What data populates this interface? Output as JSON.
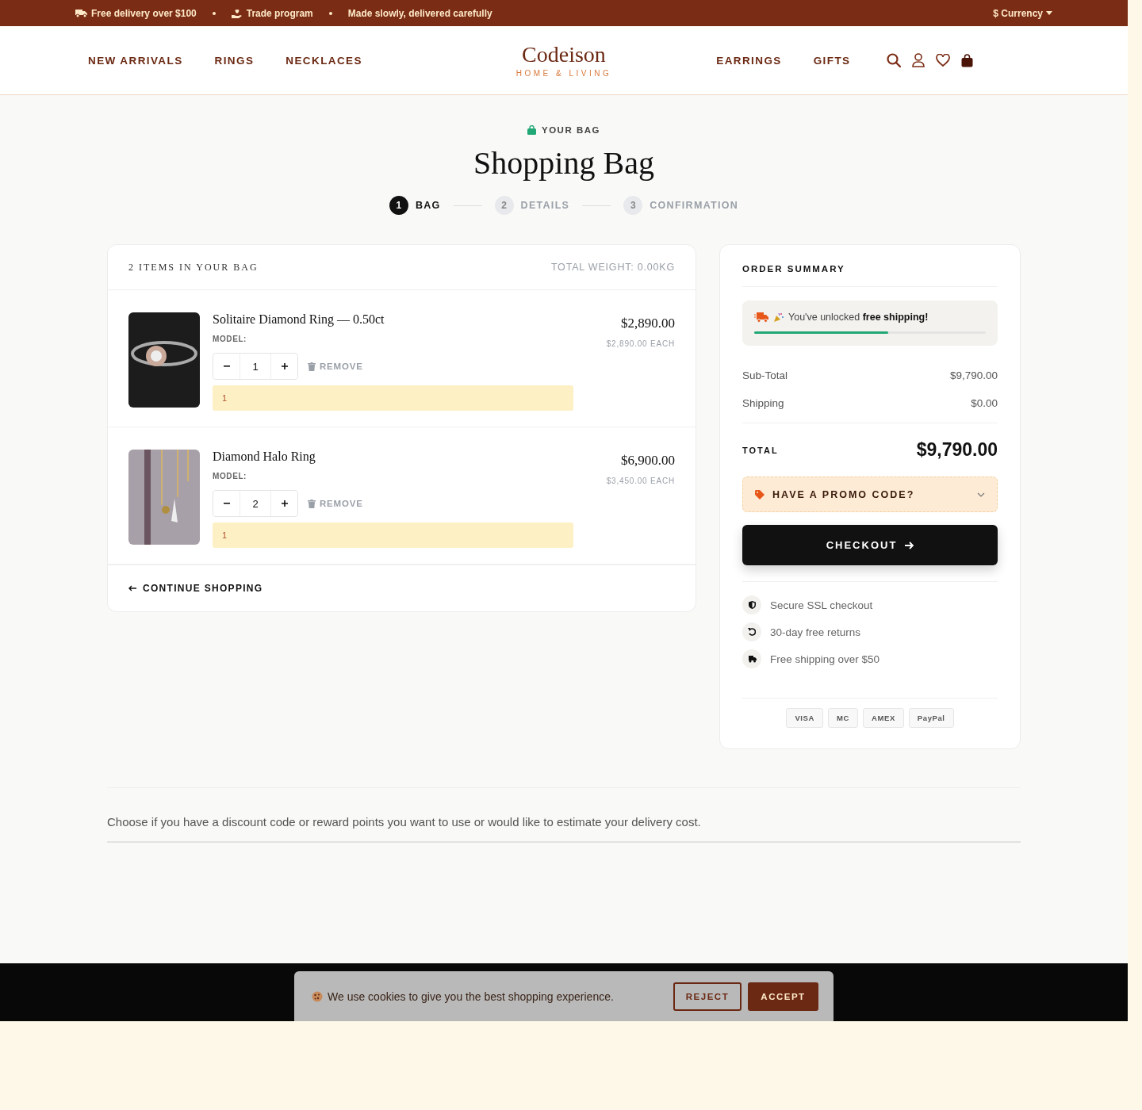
{
  "top_bar": {
    "items": [
      {
        "kind": "truck",
        "text": "Free delivery over $100"
      },
      {
        "kind": "hand",
        "text": "Trade program"
      },
      {
        "kind": "plain",
        "text": "Made slowly, delivered carefully"
      }
    ],
    "currency": "$ Currency"
  },
  "nav": {
    "left": [
      "NEW ARRIVALS",
      "RINGS",
      "NECKLACES"
    ],
    "logo": "Codeison",
    "tagline": "HOME & LIVING",
    "right": [
      "EARRINGS",
      "GIFTS"
    ]
  },
  "heading": {
    "eyebrow": "YOUR BAG",
    "title": "Shopping Bag"
  },
  "steps": [
    {
      "number": "1",
      "label": "BAG",
      "selected": true
    },
    {
      "number": "2",
      "label": "DETAILS",
      "selected": false
    },
    {
      "number": "3",
      "label": "CONFIRMATION",
      "selected": false
    }
  ],
  "bag": {
    "count_label": "2 ITEMS IN YOUR BAG",
    "weight": "TOTAL WEIGHT: 0.00KG",
    "items": [
      {
        "kind": "ring",
        "name": "Solitaire Diamond Ring — 0.50ct",
        "model_label": "MODEL:",
        "quantity": "1",
        "remove": "REMOVE",
        "note": "1",
        "price": "$2,890.00",
        "unit_price": "$2,890.00 EACH"
      },
      {
        "kind": "pendant",
        "name": "Diamond Halo Ring",
        "model_label": "MODEL:",
        "quantity": "2",
        "remove": "REMOVE",
        "note": "1",
        "price": "$6,900.00",
        "unit_price": "$3,450.00 EACH"
      }
    ],
    "continue": "CONTINUE SHOPPING"
  },
  "summary": {
    "title": "ORDER SUMMARY",
    "shipping_message": "You've unlocked **free shipping!**",
    "shipping_progress": {
      "level": 0.58
    },
    "lines": [
      {
        "label": "Sub-Total",
        "value": "$9,790.00"
      },
      {
        "label": "Shipping",
        "value": "$0.00"
      }
    ],
    "total_label": "TOTAL",
    "total": "$9,790.00",
    "promo": "HAVE A PROMO CODE?",
    "checkout": "CHECKOUT",
    "assurances": [
      {
        "kind": "shield",
        "text": "Secure SSL checkout"
      },
      {
        "kind": "returns",
        "text": "30-day free returns"
      },
      {
        "kind": "truck",
        "text": "Free shipping over $50"
      }
    ],
    "payments": [
      "VISA",
      "MC",
      "AMEX",
      "PayPal"
    ]
  },
  "info_text": "Choose if you have a discount code or reward points you want to use or would like to estimate your delivery cost.",
  "cookie": {
    "text": "We use cookies to give you the best shopping experience.",
    "reject": "REJECT",
    "accept": "ACCEPT"
  }
}
